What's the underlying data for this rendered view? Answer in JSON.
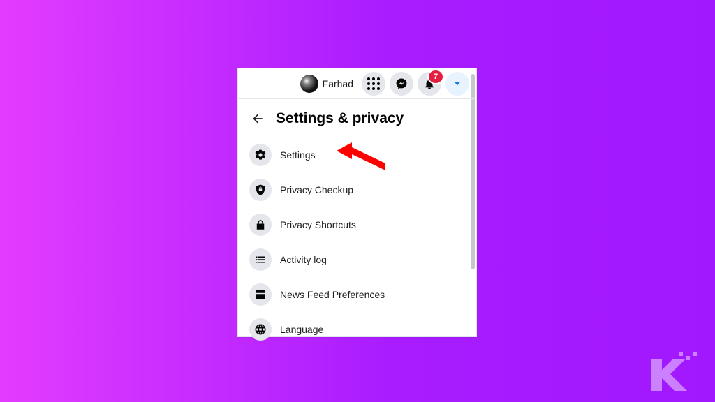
{
  "topbar": {
    "username": "Farhad",
    "notification_count": "7"
  },
  "panel": {
    "title": "Settings & privacy",
    "items": [
      {
        "label": "Settings"
      },
      {
        "label": "Privacy Checkup"
      },
      {
        "label": "Privacy Shortcuts"
      },
      {
        "label": "Activity log"
      },
      {
        "label": "News Feed Preferences"
      },
      {
        "label": "Language"
      }
    ]
  },
  "annotation": {
    "arrow_color": "#ff0000"
  },
  "watermark": {
    "letter": "K"
  }
}
